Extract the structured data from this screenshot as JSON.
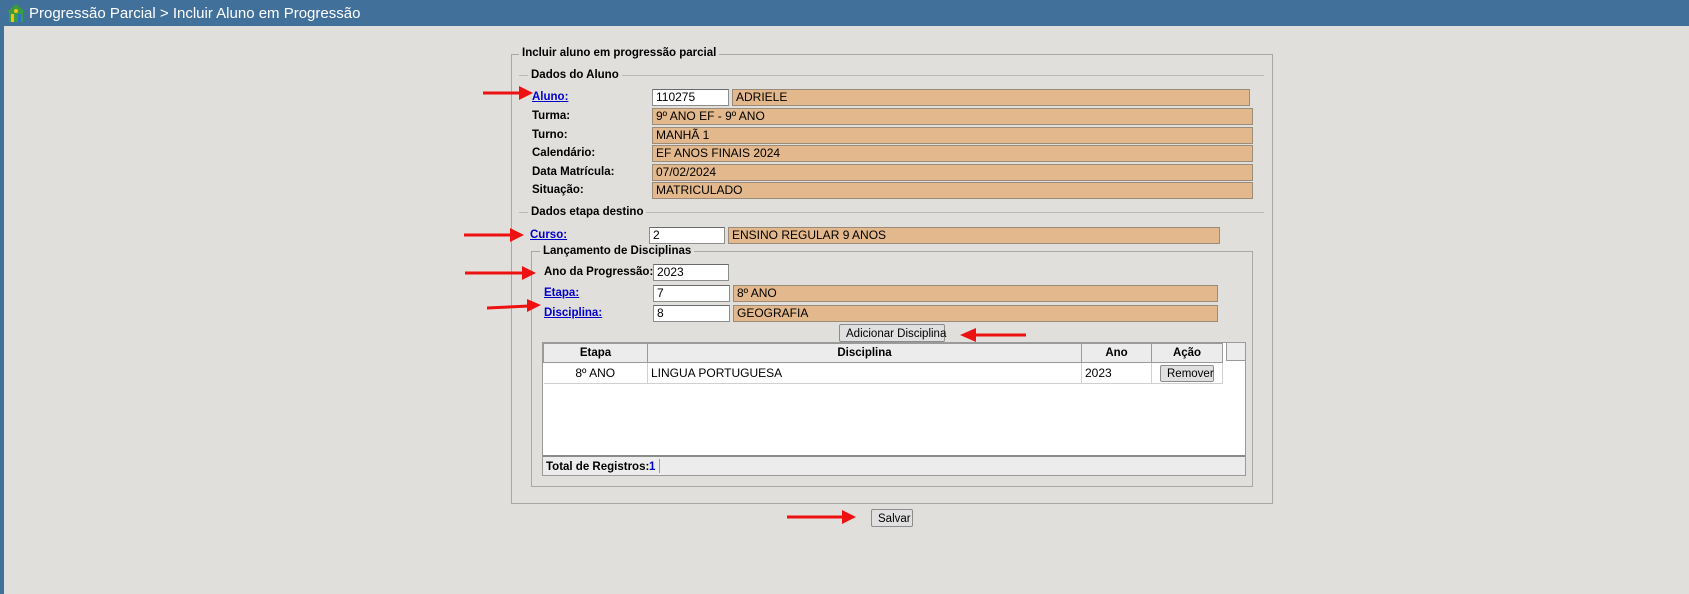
{
  "header": {
    "title": "Progressão Parcial > Incluir Aluno em Progressão"
  },
  "form": {
    "legend": "Incluir aluno em progressão parcial",
    "aluno_section": {
      "title": "Dados do Aluno",
      "aluno_label": "Aluno:",
      "aluno_code": "110275",
      "aluno_name": "ADRIELE",
      "turma_label": "Turma:",
      "turma_value": "9º ANO EF - 9º ANO",
      "turno_label": "Turno:",
      "turno_value": "MANHÃ 1",
      "calendario_label": "Calendário:",
      "calendario_value": "EF ANOS FINAIS 2024",
      "data_label": "Data Matrícula:",
      "data_value": "07/02/2024",
      "situacao_label": "Situação:",
      "situacao_value": "MATRICULADO"
    },
    "destino_section": {
      "title": "Dados etapa destino",
      "curso_label": "Curso:",
      "curso_code": "2",
      "curso_name": "ENSINO REGULAR 9 ANOS"
    },
    "disciplinas": {
      "legend": "Lançamento de Disciplinas",
      "ano_label": "Ano da Progressão:",
      "ano_value": "2023",
      "etapa_label": "Etapa:",
      "etapa_code": "7",
      "etapa_name": "8º ANO",
      "disciplina_label": "Disciplina:",
      "disciplina_code": "8",
      "disciplina_name": "GEOGRAFIA",
      "add_button": "Adicionar Disciplina",
      "table": {
        "columns": [
          "Etapa",
          "Disciplina",
          "Ano",
          "Ação"
        ],
        "rows": [
          {
            "etapa": "8º ANO",
            "disciplina": "LINGUA PORTUGUESA",
            "ano": "2023",
            "acao": "Remover"
          }
        ]
      },
      "total_label": "Total de Registros:",
      "total_value": "1"
    },
    "save_button": "Salvar"
  },
  "colors": {
    "titlebar": "#41709b",
    "background": "#e1dfdc",
    "readonly_field": "#e2b88c",
    "link": "#0000cc",
    "annotation_arrow": "#ee1111"
  }
}
